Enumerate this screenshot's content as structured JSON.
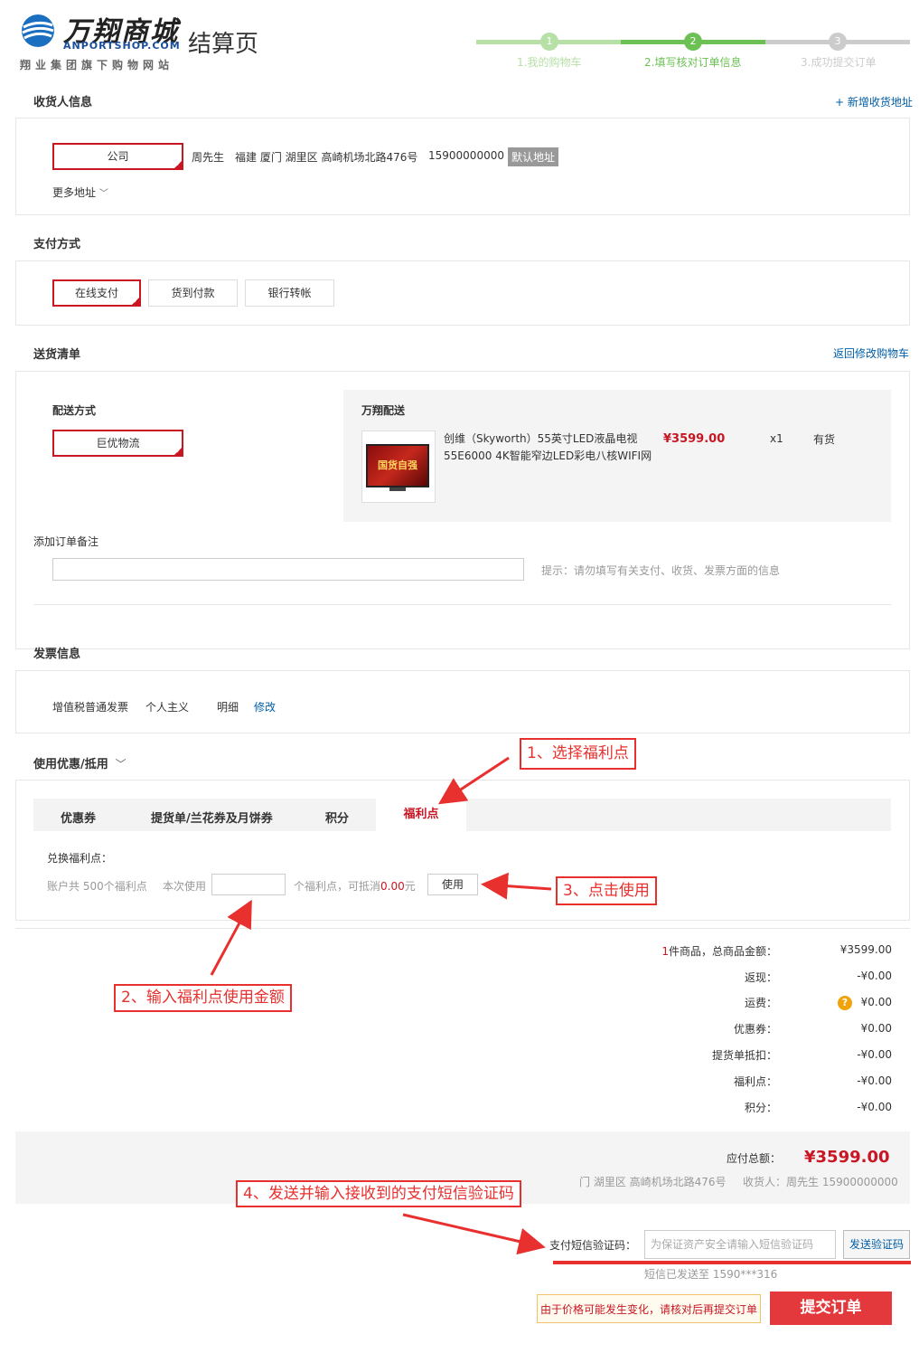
{
  "header": {
    "logo_cn": "万翔商城",
    "logo_en": "ANPORTSHOP.COM",
    "logo_slogan": "翔业集团旗下购物网站",
    "page_title": "结算页",
    "steps": [
      {
        "num": "1",
        "label": "1.我的购物车",
        "state": "done"
      },
      {
        "num": "2",
        "label": "2.填写核对订单信息",
        "state": "current"
      },
      {
        "num": "3",
        "label": "3.成功提交订单",
        "state": "todo"
      }
    ]
  },
  "consignee": {
    "title": "收货人信息",
    "add_link": "+ 新增收货地址",
    "selected_tag": "公司",
    "name": "周先生",
    "address": "福建 厦门 湖里区 高崎机场北路476号",
    "phone": "15900000000",
    "default_badge": "默认地址",
    "more": "更多地址"
  },
  "payment": {
    "title": "支付方式",
    "options": [
      "在线支付",
      "货到付款",
      "银行转帐"
    ],
    "selected": "在线支付"
  },
  "shipping": {
    "title": "送货清单",
    "back_link": "返回修改购物车",
    "method_label": "配送方式",
    "method": "巨优物流",
    "vendor": "万翔配送",
    "product_name_1": "创维（Skyworth）55英寸LED液晶电视",
    "product_name_2": "55E6000 4K智能窄边LED彩电八核WIFI网",
    "price": "¥3599.00",
    "qty": "x1",
    "stock": "有货",
    "thumb_text": "国货自强",
    "note_label": "添加订单备注",
    "note_hint": "提示：请勿填写有关支付、收货、发票方面的信息"
  },
  "invoice": {
    "title": "发票信息",
    "type": "增值税普通发票",
    "header": "个人主义",
    "content": "明细",
    "edit": "修改"
  },
  "discount": {
    "title": "使用优惠/抵用",
    "tabs": [
      "优惠券",
      "提货单/兰花券及月饼券",
      "积分",
      "福利点"
    ],
    "active_tab": "福利点",
    "exchange_label": "兑换福利点：",
    "account_text": "账户共 500个福利点",
    "use_label": "本次使用",
    "unit_text": "个福利点，可抵消",
    "offset_amount": "0.00",
    "yuan": "元",
    "use_button": "使用"
  },
  "summary": {
    "count": "1",
    "count_suffix": "件商品，总商品金额：",
    "rows": [
      {
        "label": "返现：",
        "value": "-¥0.00"
      },
      {
        "label": "运费：",
        "value": "¥0.00"
      },
      {
        "label": "优惠券：",
        "value": "¥0.00"
      },
      {
        "label": "提货单抵扣：",
        "value": "-¥0.00"
      },
      {
        "label": "福利点：",
        "value": "-¥0.00"
      },
      {
        "label": "积分：",
        "value": "-¥0.00"
      }
    ],
    "goods_total": "¥3599.00",
    "freight_icon": "?",
    "payable_label": "应付总额：",
    "payable": "¥3599.00",
    "address_short": "门 湖里区 高崎机场北路476号",
    "receiver": "收货人：周先生 15900000000"
  },
  "sms": {
    "label": "支付短信验证码：",
    "placeholder": "为保证资产安全请输入短信验证码",
    "send_button": "发送验证码",
    "sent_to": "短信已发送至 1590***316"
  },
  "footer": {
    "warning": "由于价格可能发生变化，请核对后再提交订单",
    "submit": "提交订单"
  },
  "annotations": {
    "a1": "1、选择福利点",
    "a2": "2、输入福利点使用金额",
    "a3": "3、点击使用",
    "a4": "4、发送并输入接收到的支付短信验证码"
  },
  "colors": {
    "accent_red": "#c81623",
    "step_green": "#6dc054",
    "step_light_green": "#b7e0a6",
    "annotation_red": "#e8302e"
  }
}
